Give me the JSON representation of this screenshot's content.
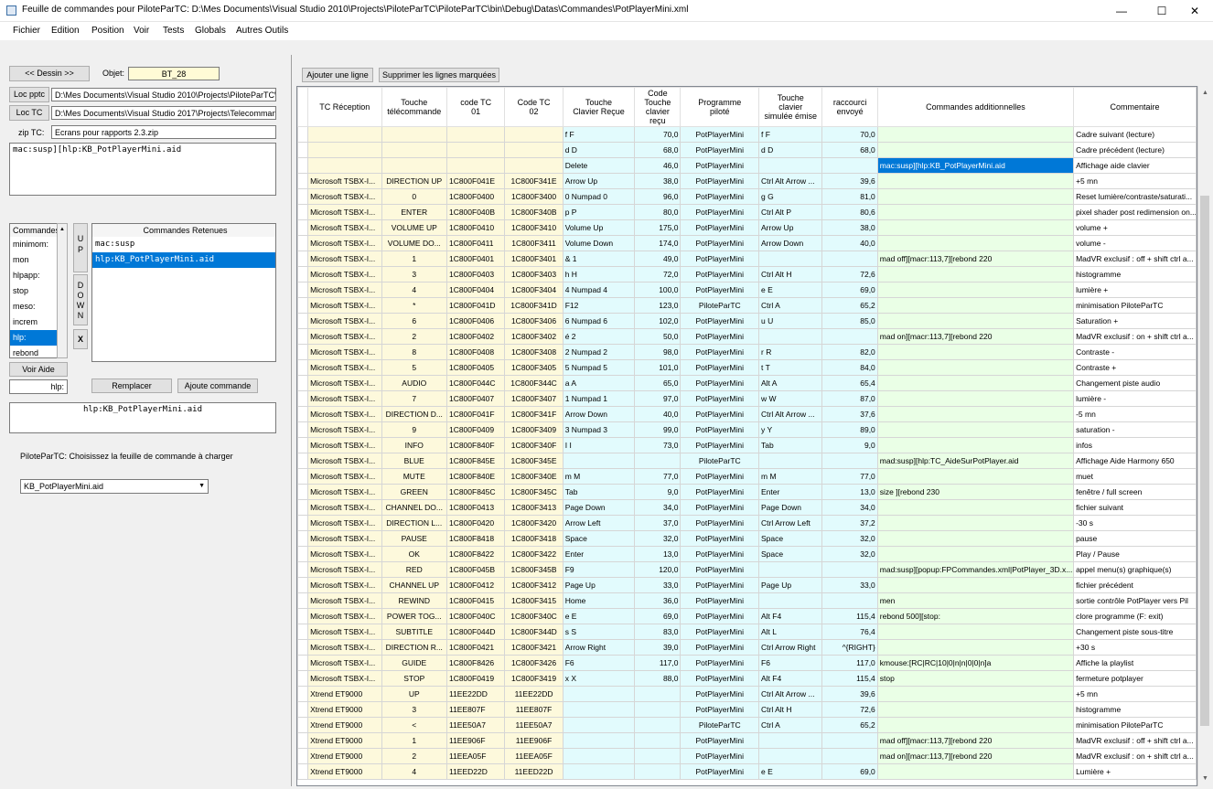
{
  "window": {
    "title": "Feuille de commandes pour PiloteParTC: D:\\Mes Documents\\Visual Studio 2010\\Projects\\PiloteParTC\\PiloteParTC\\bin\\Debug\\Datas\\Commandes\\PotPlayerMini.xml",
    "minimize": "—",
    "maximize": "☐",
    "close": "✕"
  },
  "menu": [
    "Fichier",
    "Edition",
    "Position",
    "Voir",
    "Tests",
    "Globals",
    "Autres Outils"
  ],
  "left": {
    "dessin_button": "<< Dessin >>",
    "objet_label": "Objet:",
    "objet_value": "BT_28",
    "loc_pptc_button": "Loc pptc",
    "loc_pptc_path": "D:\\Mes Documents\\Visual Studio 2010\\Projects\\PiloteParTC\\Pil",
    "loc_tc_button": "Loc TC",
    "loc_tc_path": "D:\\Mes Documents\\Visual Studio 2017\\Projects\\Telecommande\\",
    "zip_label": "zip TC:",
    "zip_value": "Ecrans pour rapports 2.3.zip",
    "command_text": "mac:susp][hlp:KB_PotPlayerMini.aid",
    "commandes_list_header": "Commandes",
    "commandes_list": [
      "minimom:",
      "mon",
      "hlpapp:",
      "stop",
      "meso:",
      "increm",
      "hlp:",
      "rebond"
    ],
    "commandes_selected_index": 6,
    "up_button": "U\nP",
    "down_button": "D\nO\nW\nN",
    "x_button": "X",
    "retenues_header": "Commandes Retenues",
    "retenues": [
      "mac:susp",
      "hlp:KB_PotPlayerMini.aid"
    ],
    "retenues_selected_index": 1,
    "voir_aide_button": "Voir Aide",
    "hlp_value": "hlp:",
    "remplacer_button": "Remplacer",
    "ajoute_button": "Ajoute commande",
    "help_text": "hlp:KB_PotPlayerMini.aid",
    "choose_label": "PiloteParTC: Choisissez la feuille de commande à charger",
    "choose_value": "KB_PotPlayerMini.aid",
    "dropdown_arrow": "▼"
  },
  "toolbar": {
    "add_row": "Ajouter une ligne",
    "delete_rows": "Supprimer les lignes marquées"
  },
  "grid": {
    "columns": [
      "TC Réception",
      "Touche\ntélécommande",
      "code TC\n01",
      "Code TC\n02",
      "Touche\nClavier Reçue",
      "Code\nTouche\nclavier\nreçu",
      "Programme\npiloté",
      "Touche\nclavier\nsimulée émise",
      "raccourci\nenvoyé",
      "Commandes additionnelles",
      "Commentaire"
    ],
    "rows": [
      [
        "",
        "",
        "",
        "",
        "f  F",
        "70,0",
        "PotPlayerMini",
        "f  F",
        "70,0",
        "",
        "Cadre suivant (lecture)"
      ],
      [
        "",
        "",
        "",
        "",
        "d  D",
        "68,0",
        "PotPlayerMini",
        "d  D",
        "68,0",
        "",
        "Cadre précédent (lecture)"
      ],
      [
        "",
        "",
        "",
        "",
        "Delete",
        "46,0",
        "PotPlayerMini",
        "",
        "",
        "mac:susp][hlp:KB_PotPlayerMini.aid",
        "Affichage aide clavier"
      ],
      [
        "Microsoft TSBX-I...",
        "DIRECTION UP",
        "1C800F041E",
        "1C800F341E",
        "Arrow Up",
        "38,0",
        "PotPlayerMini",
        "Ctrl Alt Arrow ...",
        "39,6",
        "",
        "+5 mn"
      ],
      [
        "Microsoft TSBX-I...",
        "0",
        "1C800F0400",
        "1C800F3400",
        "0  Numpad 0",
        "96,0",
        "PotPlayerMini",
        "g  G",
        "81,0",
        "",
        "Reset lumière/contraste/saturati..."
      ],
      [
        "Microsoft TSBX-I...",
        "ENTER",
        "1C800F040B",
        "1C800F340B",
        "p  P",
        "80,0",
        "PotPlayerMini",
        "Ctrl Alt P",
        "80,6",
        "",
        "pixel shader post redimension on..."
      ],
      [
        "Microsoft TSBX-I...",
        "VOLUME UP",
        "1C800F0410",
        "1C800F3410",
        "Volume Up",
        "175,0",
        "PotPlayerMini",
        "Arrow Up",
        "38,0",
        "",
        "volume +"
      ],
      [
        "Microsoft TSBX-I...",
        "VOLUME DO...",
        "1C800F0411",
        "1C800F3411",
        "Volume Down",
        "174,0",
        "PotPlayerMini",
        "Arrow Down",
        "40,0",
        "",
        "volume -"
      ],
      [
        "Microsoft TSBX-I...",
        "1",
        "1C800F0401",
        "1C800F3401",
        "&  1",
        "49,0",
        "PotPlayerMini",
        "",
        "",
        "mad off][macr:113,7][rebond 220",
        "MadVR exclusif : off + shift ctrl a..."
      ],
      [
        "Microsoft TSBX-I...",
        "3",
        "1C800F0403",
        "1C800F3403",
        "h  H",
        "72,0",
        "PotPlayerMini",
        "Ctrl Alt H",
        "72,6",
        "",
        "histogramme"
      ],
      [
        "Microsoft TSBX-I...",
        "4",
        "1C800F0404",
        "1C800F3404",
        "4  Numpad 4",
        "100,0",
        "PotPlayerMini",
        "e  E",
        "69,0",
        "",
        "lumière +"
      ],
      [
        "Microsoft TSBX-I...",
        "*",
        "1C800F041D",
        "1C800F341D",
        "F12",
        "123,0",
        "PiloteParTC",
        "Ctrl A",
        "65,2",
        "",
        "minimisation PiloteParTC"
      ],
      [
        "Microsoft TSBX-I...",
        "6",
        "1C800F0406",
        "1C800F3406",
        "6  Numpad 6",
        "102,0",
        "PotPlayerMini",
        "u  U",
        "85,0",
        "",
        "Saturation +"
      ],
      [
        "Microsoft TSBX-I...",
        "2",
        "1C800F0402",
        "1C800F3402",
        "é  2",
        "50,0",
        "PotPlayerMini",
        "",
        "",
        "mad on][macr:113,7][rebond 220",
        "MadVR exclusif : on + shift ctrl a..."
      ],
      [
        "Microsoft TSBX-I...",
        "8",
        "1C800F0408",
        "1C800F3408",
        "2  Numpad 2",
        "98,0",
        "PotPlayerMini",
        "r  R",
        "82,0",
        "",
        "Contraste -"
      ],
      [
        "Microsoft TSBX-I...",
        "5",
        "1C800F0405",
        "1C800F3405",
        "5  Numpad 5",
        "101,0",
        "PotPlayerMini",
        "t  T",
        "84,0",
        "",
        "Contraste +"
      ],
      [
        "Microsoft TSBX-I...",
        "AUDIO",
        "1C800F044C",
        "1C800F344C",
        "a  A",
        "65,0",
        "PotPlayerMini",
        "Alt A",
        "65,4",
        "",
        "Changement piste audio"
      ],
      [
        "Microsoft TSBX-I...",
        "7",
        "1C800F0407",
        "1C800F3407",
        "1  Numpad 1",
        "97,0",
        "PotPlayerMini",
        "w  W",
        "87,0",
        "",
        "lumière -"
      ],
      [
        "Microsoft TSBX-I...",
        "DIRECTION D...",
        "1C800F041F",
        "1C800F341F",
        "Arrow Down",
        "40,0",
        "PotPlayerMini",
        "Ctrl Alt Arrow ...",
        "37,6",
        "",
        "-5 mn"
      ],
      [
        "Microsoft TSBX-I...",
        "9",
        "1C800F0409",
        "1C800F3409",
        "3  Numpad 3",
        "99,0",
        "PotPlayerMini",
        "y  Y",
        "89,0",
        "",
        "saturation -"
      ],
      [
        "Microsoft TSBX-I...",
        "INFO",
        "1C800F840F",
        "1C800F340F",
        "I  I",
        "73,0",
        "PotPlayerMini",
        "Tab",
        "9,0",
        "",
        "infos"
      ],
      [
        "Microsoft TSBX-I...",
        "BLUE",
        "1C800F845E",
        "1C800F345E",
        "",
        "",
        "PiloteParTC",
        "",
        "",
        "mad:susp][hlp:TC_AideSurPotPlayer.aid",
        "Affichage Aide Harmony 650"
      ],
      [
        "Microsoft TSBX-I...",
        "MUTE",
        "1C800F840E",
        "1C800F340E",
        "m  M",
        "77,0",
        "PotPlayerMini",
        "m  M",
        "77,0",
        "",
        "muet"
      ],
      [
        "Microsoft TSBX-I...",
        "GREEN",
        "1C800F845C",
        "1C800F345C",
        "Tab",
        "9,0",
        "PotPlayerMini",
        "Enter",
        "13,0",
        "size ][rebond 230",
        "fenêtre / full screen"
      ],
      [
        "Microsoft TSBX-I...",
        "CHANNEL DO...",
        "1C800F0413",
        "1C800F3413",
        "Page Down",
        "34,0",
        "PotPlayerMini",
        "Page Down",
        "34,0",
        "",
        "fichier suivant"
      ],
      [
        "Microsoft TSBX-I...",
        "DIRECTION L...",
        "1C800F0420",
        "1C800F3420",
        "Arrow Left",
        "37,0",
        "PotPlayerMini",
        "Ctrl Arrow Left",
        "37,2",
        "",
        "-30 s"
      ],
      [
        "Microsoft TSBX-I...",
        "PAUSE",
        "1C800F8418",
        "1C800F3418",
        "Space",
        "32,0",
        "PotPlayerMini",
        "Space",
        "32,0",
        "",
        "pause"
      ],
      [
        "Microsoft TSBX-I...",
        "OK",
        "1C800F8422",
        "1C800F3422",
        "Enter",
        "13,0",
        "PotPlayerMini",
        "Space",
        "32,0",
        "",
        "Play / Pause"
      ],
      [
        "Microsoft TSBX-I...",
        "RED",
        "1C800F045B",
        "1C800F345B",
        "F9",
        "120,0",
        "PotPlayerMini",
        "",
        "",
        "mad:susp][popup:FPCommandes.xml|PotPlayer_3D.x...",
        "appel menu(s) graphique(s)"
      ],
      [
        "Microsoft TSBX-I...",
        "CHANNEL UP",
        "1C800F0412",
        "1C800F3412",
        "Page Up",
        "33,0",
        "PotPlayerMini",
        "Page Up",
        "33,0",
        "",
        "fichier précédent"
      ],
      [
        "Microsoft TSBX-I...",
        "REWIND",
        "1C800F0415",
        "1C800F3415",
        "Home",
        "36,0",
        "PotPlayerMini",
        "",
        "",
        "men",
        "sortie contrôle PotPlayer vers Pil"
      ],
      [
        "Microsoft TSBX-I...",
        "POWER TOG...",
        "1C800F040C",
        "1C800F340C",
        "e  E",
        "69,0",
        "PotPlayerMini",
        "Alt F4",
        "115,4",
        "rebond 500][stop:",
        "clore programme (F: exit)"
      ],
      [
        "Microsoft TSBX-I...",
        "SUBTITLE",
        "1C800F044D",
        "1C800F344D",
        "s  S",
        "83,0",
        "PotPlayerMini",
        "Alt L",
        "76,4",
        "",
        "Changement piste sous-titre"
      ],
      [
        "Microsoft TSBX-I...",
        "DIRECTION R...",
        "1C800F0421",
        "1C800F3421",
        "Arrow Right",
        "39,0",
        "PotPlayerMini",
        "Ctrl Arrow Right",
        "^{RIGHT}",
        "",
        "+30 s"
      ],
      [
        "Microsoft TSBX-I...",
        "GUIDE",
        "1C800F8426",
        "1C800F3426",
        "F6",
        "117,0",
        "PotPlayerMini",
        "F6",
        "117,0",
        "kmouse:[RC|RC|10|0|n|n|0|0|n]a",
        "Affiche la playlist"
      ],
      [
        "Microsoft TSBX-I...",
        "STOP",
        "1C800F0419",
        "1C800F3419",
        "x  X",
        "88,0",
        "PotPlayerMini",
        "Alt F4",
        "115,4",
        "stop",
        "fermeture potplayer"
      ],
      [
        "Xtrend ET9000",
        "UP",
        "11EE22DD",
        "11EE22DD",
        "",
        "",
        "PotPlayerMini",
        "Ctrl Alt Arrow ...",
        "39,6",
        "",
        "+5 mn"
      ],
      [
        "Xtrend ET9000",
        "3",
        "11EE807F",
        "11EE807F",
        "",
        "",
        "PotPlayerMini",
        "Ctrl Alt H",
        "72,6",
        "",
        "histogramme"
      ],
      [
        "Xtrend ET9000",
        "<",
        "11EE50A7",
        "11EE50A7",
        "",
        "",
        "PiloteParTC",
        "Ctrl A",
        "65,2",
        "",
        "minimisation PiloteParTC"
      ],
      [
        "Xtrend ET9000",
        "1",
        "11EE906F",
        "11EE906F",
        "",
        "",
        "PotPlayerMini",
        "",
        "",
        "mad off][macr:113,7][rebond 220",
        "MadVR exclusif : off + shift ctrl a..."
      ],
      [
        "Xtrend ET9000",
        "2",
        "11EEA05F",
        "11EEA05F",
        "",
        "",
        "PotPlayerMini",
        "",
        "",
        "mad on][macr:113,7][rebond 220",
        "MadVR exclusif : on + shift ctrl a..."
      ],
      [
        "Xtrend ET9000",
        "4",
        "11EED22D",
        "11EED22D",
        "",
        "",
        "PotPlayerMini",
        "e  E",
        "69,0",
        "",
        "Lumière +"
      ]
    ],
    "selected_row": 2,
    "selected_col": 9
  },
  "scroll": {
    "up": "▲",
    "down": "▼"
  }
}
